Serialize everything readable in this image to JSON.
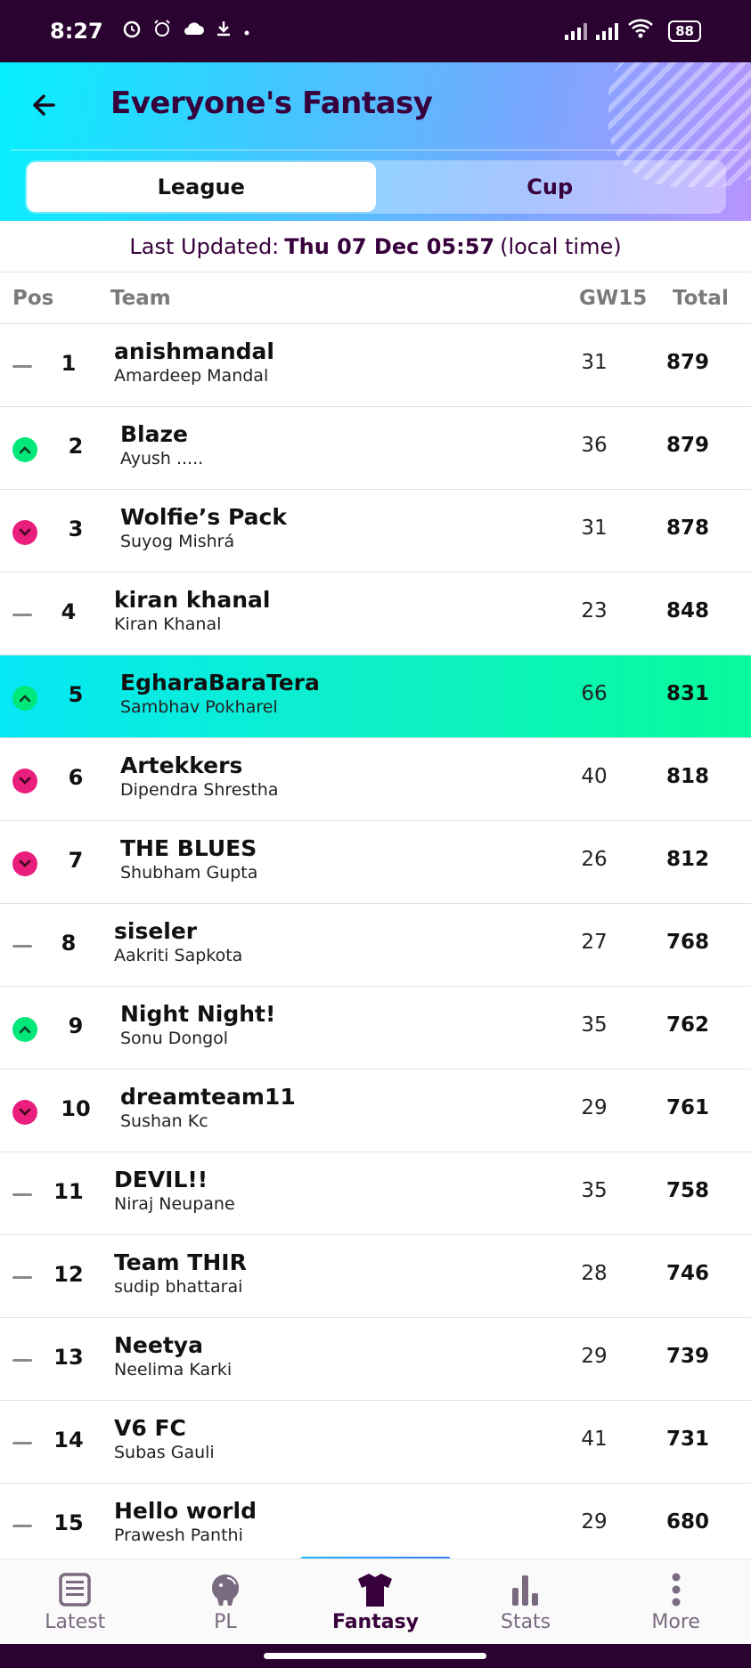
{
  "status_bar": {
    "time": "8:27",
    "battery": "88",
    "icons": [
      "alarm-icon",
      "alarm-clock-icon",
      "cloud-icon",
      "download-icon",
      "dot-icon",
      "signal-icon",
      "signal-icon",
      "wifi-icon",
      "battery-icon"
    ]
  },
  "header": {
    "title": "Everyone's Fantasy",
    "back_icon": "back-arrow-icon",
    "tabs": [
      {
        "label": "League",
        "active": true
      },
      {
        "label": "Cup",
        "active": false
      }
    ]
  },
  "last_updated": {
    "label": "Last Updated:",
    "value": "Thu 07 Dec 05:57",
    "suffix": "(local time)"
  },
  "table": {
    "columns": {
      "pos": "Pos",
      "team": "Team",
      "gw": "GW15",
      "total": "Total"
    },
    "rows": [
      {
        "pos": "1",
        "move": "same",
        "team": "anishmandal",
        "manager": "Amardeep Mandal",
        "gw": "31",
        "total": "879"
      },
      {
        "pos": "2",
        "move": "up",
        "team": "Blaze",
        "manager": "Ayush .....",
        "gw": "36",
        "total": "879"
      },
      {
        "pos": "3",
        "move": "down",
        "team": "Wolfie’s Pack",
        "manager": "Suyog Mishrá",
        "gw": "31",
        "total": "878"
      },
      {
        "pos": "4",
        "move": "same",
        "team": "kiran khanal",
        "manager": "Kiran Khanal",
        "gw": "23",
        "total": "848"
      },
      {
        "pos": "5",
        "move": "up",
        "team": "EgharaBaraTera",
        "manager": "Sambhav Pokharel",
        "gw": "66",
        "total": "831",
        "highlight": true
      },
      {
        "pos": "6",
        "move": "down",
        "team": "Artekkers",
        "manager": "Dipendra Shrestha",
        "gw": "40",
        "total": "818"
      },
      {
        "pos": "7",
        "move": "down",
        "team": "THE BLUES",
        "manager": "Shubham Gupta",
        "gw": "26",
        "total": "812"
      },
      {
        "pos": "8",
        "move": "same",
        "team": "siseler",
        "manager": "Aakriti Sapkota",
        "gw": "27",
        "total": "768"
      },
      {
        "pos": "9",
        "move": "up",
        "team": "Night Night!",
        "manager": "Sonu Dongol",
        "gw": "35",
        "total": "762"
      },
      {
        "pos": "10",
        "move": "down",
        "team": "dreamteam11",
        "manager": "Sushan Kc",
        "gw": "29",
        "total": "761"
      },
      {
        "pos": "11",
        "move": "same",
        "team": "DEVIL!!",
        "manager": "Niraj Neupane",
        "gw": "35",
        "total": "758"
      },
      {
        "pos": "12",
        "move": "same",
        "team": "Team THIR",
        "manager": "sudip bhattarai",
        "gw": "28",
        "total": "746"
      },
      {
        "pos": "13",
        "move": "same",
        "team": "Neetya",
        "manager": "Neelima Karki",
        "gw": "29",
        "total": "739"
      },
      {
        "pos": "14",
        "move": "same",
        "team": "V6 FC",
        "manager": "Subas Gauli",
        "gw": "41",
        "total": "731"
      },
      {
        "pos": "15",
        "move": "same",
        "team": "Hello world",
        "manager": "Prawesh Panthi",
        "gw": "29",
        "total": "680"
      }
    ]
  },
  "bottom_nav": {
    "items": [
      {
        "label": "Latest",
        "icon": "news-icon",
        "active": false
      },
      {
        "label": "PL",
        "icon": "lion-logo-icon",
        "active": false
      },
      {
        "label": "Fantasy",
        "icon": "shirt-icon",
        "active": true
      },
      {
        "label": "Stats",
        "icon": "bar-chart-icon",
        "active": false
      },
      {
        "label": "More",
        "icon": "more-vertical-icon",
        "active": false
      }
    ]
  },
  "colors": {
    "brand_purple": "#37003c",
    "up": "#00e87a",
    "down": "#e91e7d",
    "highlight_start": "#05e8f5",
    "highlight_end": "#07fa9a"
  }
}
